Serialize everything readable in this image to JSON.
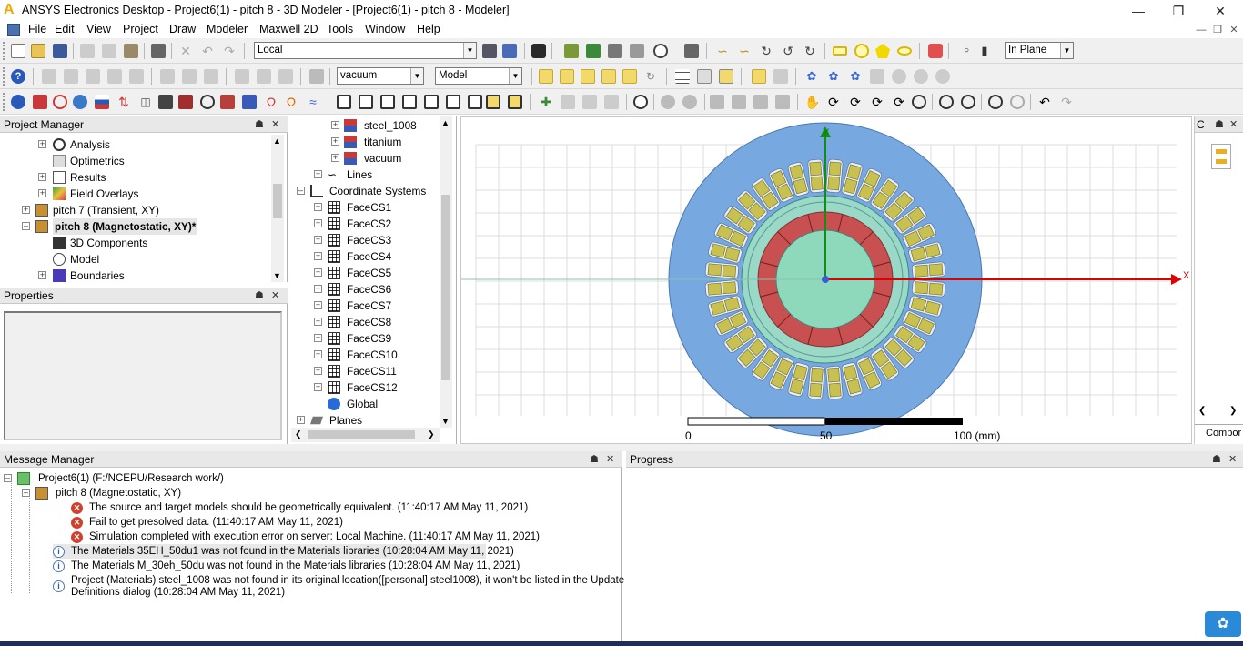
{
  "window": {
    "title": "ANSYS Electronics Desktop - Project6(1) - pitch  8 - 3D Modeler - [Project6(1) - pitch  8 - Modeler]",
    "logo": "A"
  },
  "menu": [
    "File",
    "Edit",
    "View",
    "Project",
    "Draw",
    "Modeler",
    "Maxwell 2D",
    "Tools",
    "Window",
    "Help"
  ],
  "toolbar": {
    "coord_system": "Local",
    "material": "vacuum",
    "model_type": "Model",
    "plane_mode": "In Plane"
  },
  "project_manager": {
    "title": "Project Manager",
    "items": [
      {
        "label": "Analysis"
      },
      {
        "label": "Optimetrics"
      },
      {
        "label": "Results"
      },
      {
        "label": "Field Overlays"
      },
      {
        "label": "pitch  7 (Transient, XY)"
      },
      {
        "label": "pitch  8 (Magnetostatic, XY)*"
      },
      {
        "label": "3D Components"
      },
      {
        "label": "Model"
      },
      {
        "label": "Boundaries"
      }
    ]
  },
  "properties": {
    "title": "Properties"
  },
  "model_tree": {
    "items": [
      {
        "label": "steel_1008"
      },
      {
        "label": "titanium"
      },
      {
        "label": "vacuum"
      },
      {
        "label": "Lines"
      },
      {
        "label": "Coordinate Systems"
      },
      {
        "label": "FaceCS1"
      },
      {
        "label": "FaceCS2"
      },
      {
        "label": "FaceCS3"
      },
      {
        "label": "FaceCS4"
      },
      {
        "label": "FaceCS5"
      },
      {
        "label": "FaceCS6"
      },
      {
        "label": "FaceCS7"
      },
      {
        "label": "FaceCS8"
      },
      {
        "label": "FaceCS9"
      },
      {
        "label": "FaceCS10"
      },
      {
        "label": "FaceCS11"
      },
      {
        "label": "FaceCS12"
      },
      {
        "label": "Global"
      },
      {
        "label": "Planes"
      }
    ]
  },
  "viewport": {
    "axis_x": "X",
    "axis_y": "Y",
    "scale_labels": [
      "0",
      "50",
      "100 (mm)"
    ]
  },
  "right_panel": {
    "tab": "Compor",
    "header": "C"
  },
  "message_manager": {
    "title": "Message Manager",
    "project": "Project6(1) (F:/NCEPU/Research work/)",
    "design": "pitch  8 (Magnetostatic, XY)",
    "messages": [
      {
        "type": "error",
        "text": "The source and target models should be geometrically equivalent. (11:40:17 AM  May 11, 2021)"
      },
      {
        "type": "error",
        "text": "Fail to get presolved data. (11:40:17 AM  May 11, 2021)"
      },
      {
        "type": "error",
        "text": "Simulation completed with execution error on server: Local Machine. (11:40:17 AM  May 11, 2021)"
      },
      {
        "type": "info",
        "text": "The Materials 35EH_50du1 was not found in the Materials libraries (10:28:04 AM  May 11, 2021)"
      },
      {
        "type": "info",
        "text": "The Materials M_30eh_50du was not found in the Materials libraries (10:28:04 AM  May 11, 2021)"
      },
      {
        "type": "info",
        "text": "Project (Materials) steel_1008 was not found in its original location([personal] steel1008), it won't be listed in the Update"
      },
      {
        "type": "info-cont",
        "text": "Definitions dialog (10:28:04 AM  May 11, 2021)"
      }
    ]
  },
  "progress": {
    "title": "Progress"
  },
  "colors": {
    "stator": "#78a8e0",
    "slot": "#e8eef8",
    "coil": "#c8c050",
    "airgap": "#9ad8c8",
    "magnet": "#c85050",
    "rotor": "#8ed8bc",
    "x_axis": "#e00000",
    "y_axis": "#109010"
  }
}
